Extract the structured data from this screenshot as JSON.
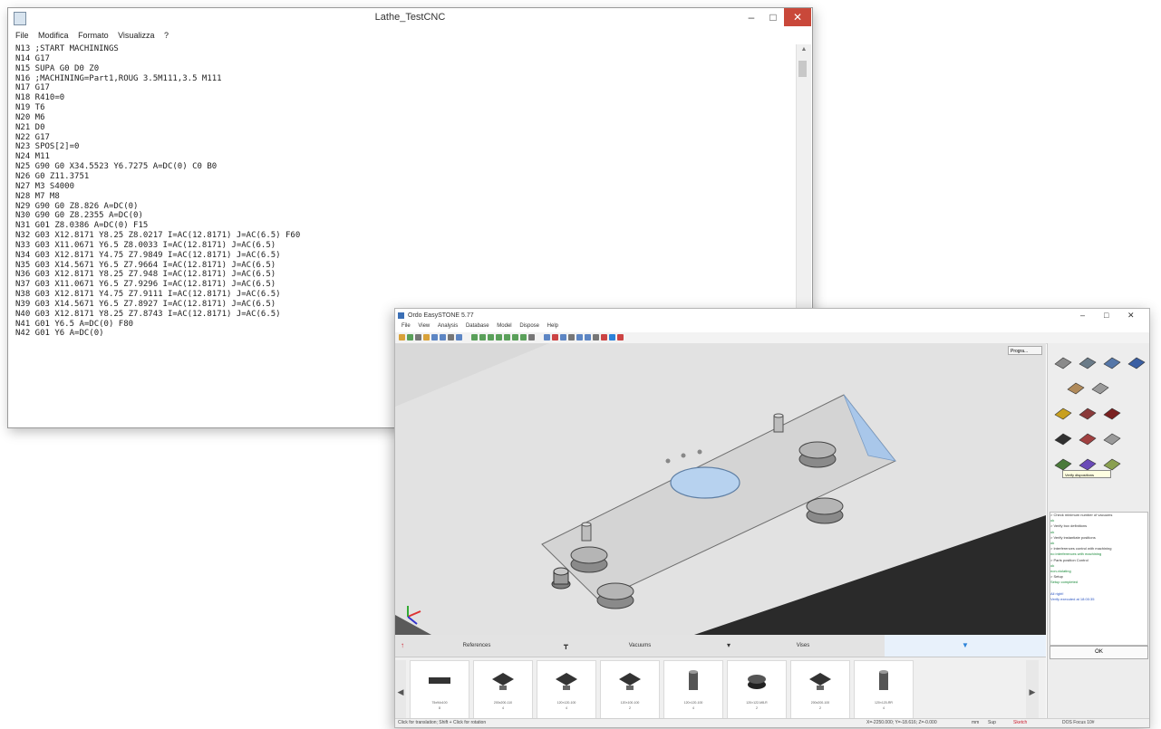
{
  "notepad": {
    "title": "Lathe_TestCNC",
    "controls": {
      "minimize": "–",
      "maximize": "□",
      "close": "✕"
    },
    "menu": [
      "File",
      "Modifica",
      "Formato",
      "Visualizza",
      "?"
    ],
    "lines": [
      "N13 ;START MACHININGS",
      "N14 G17",
      "N15 SUPA G0 D0 Z0",
      "N16 ;MACHINING=Part1,ROUG 3.5M111,3.5 M111",
      "N17 G17",
      "N18 R410=0",
      "N19 T6",
      "N20 M6",
      "N21 D0",
      "N22 G17",
      "N23 SPOS[2]=0",
      "N24 M11",
      "N25 G90 G0 X34.5523 Y6.7275 A=DC(0) C0 B0",
      "N26 G0 Z11.3751",
      "N27 M3 S4000",
      "N28 M7 M8",
      "N29 G90 G0 Z8.826 A=DC(0)",
      "N30 G90 G0 Z8.2355 A=DC(0)",
      "N31 G01 Z8.0386 A=DC(0) F15",
      "N32 G03 X12.8171 Y8.25 Z8.0217 I=AC(12.8171) J=AC(6.5) F60",
      "N33 G03 X11.0671 Y6.5 Z8.0033 I=AC(12.8171) J=AC(6.5)",
      "N34 G03 X12.8171 Y4.75 Z7.9849 I=AC(12.8171) J=AC(6.5)",
      "N35 G03 X14.5671 Y6.5 Z7.9664 I=AC(12.8171) J=AC(6.5)",
      "N36 G03 X12.8171 Y8.25 Z7.948 I=AC(12.8171) J=AC(6.5)",
      "N37 G03 X11.0671 Y6.5 Z7.9296 I=AC(12.8171) J=AC(6.5)",
      "N38 G03 X12.8171 Y4.75 Z7.9111 I=AC(12.8171) J=AC(6.5)",
      "N39 G03 X14.5671 Y6.5 Z7.8927 I=AC(12.8171) J=AC(6.5)",
      "N40 G03 X12.8171 Y8.25 Z7.8743 I=AC(12.8171) J=AC(6.5)",
      "N41 G01 Y6.5 A=DC(0) F80",
      "N42 G01 Y6 A=DC(0)"
    ]
  },
  "easystone": {
    "title": "Ordo EasySTONE 5.77",
    "controls": {
      "minimize": "–",
      "maximize": "□",
      "close": "✕"
    },
    "menu": [
      "File",
      "View",
      "Analysis",
      "Database",
      "Model",
      "Dispose",
      "Help"
    ],
    "view_dropdown": "Progra...",
    "tooltip": "Verify dispositions",
    "log_lines": [
      "> Check minimum number of vacuums",
      "   ok",
      "> Verify box definitions",
      "   ok",
      "> Verify instantiate positions",
      "   ok",
      "> Interferences control with machining",
      "   no interferences with machining",
      "> Parts position Control",
      "   ok",
      "   non-violating",
      "> Setup",
      "   Setup completed",
      "",
      "All right!",
      "Verify executed at 18:00:35"
    ],
    "ok_button": "OK",
    "tabs": [
      {
        "label": "References",
        "icon": "arrow-up-icon"
      },
      {
        "label": "Vacuums",
        "icon": "vacuum-icon"
      },
      {
        "label": "Vises",
        "icon": "vise-icon"
      },
      {
        "label": "",
        "icon": "active-tab-icon"
      }
    ],
    "vacuums": [
      {
        "label": "75x94x100",
        "count": "8"
      },
      {
        "label": "200x200-110",
        "count": "4"
      },
      {
        "label": "120×120-100",
        "count": "4"
      },
      {
        "label": "120×100-100",
        "count": "2"
      },
      {
        "label": "120×120-100",
        "count": "4"
      },
      {
        "label": "120×122-M8-R",
        "count": "2"
      },
      {
        "label": "200x200-100",
        "count": "2"
      },
      {
        "label": "120×120-RR",
        "count": "4"
      }
    ],
    "status_left": "Click for translation; Shift + Click for rotation",
    "status_right": "X=-2250.000; Y=-18.616; Z=-0.000",
    "status_items": [
      "mm",
      "Sup",
      "Sketch",
      "DOS Focus 10#"
    ]
  },
  "colors": {
    "accent_blue": "#2b82d9",
    "glass_blue": "#a9c7ea",
    "table_gray": "#e4e4e4",
    "titlebar_close_red": "#c9483a"
  }
}
